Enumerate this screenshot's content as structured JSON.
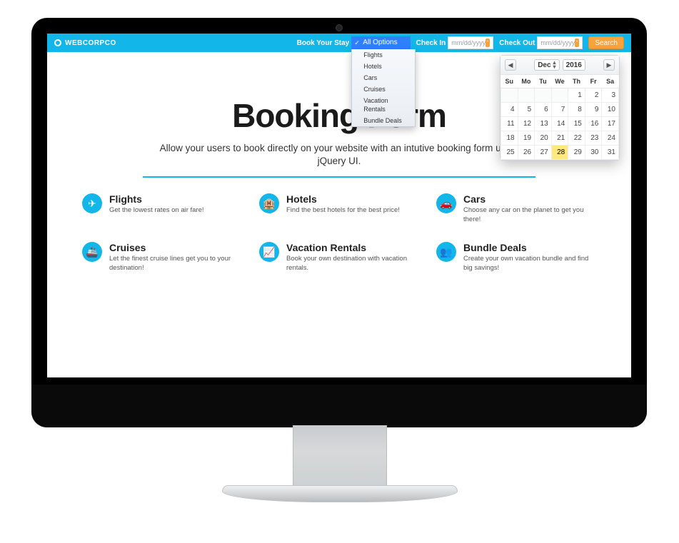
{
  "brand": {
    "name": "WEBCORPCO"
  },
  "topbar": {
    "book_label": "Book Your Stay",
    "checkin_label": "Check In",
    "checkout_label": "Check Out",
    "date_placeholder": "mm/dd/yyyy",
    "search_label": "Search",
    "select_selected": "All Options",
    "select_options": [
      "Flights",
      "Hotels",
      "Cars",
      "Cruises",
      "Vacation Rentals",
      "Bundle Deals"
    ]
  },
  "hero": {
    "title": "Booking Form",
    "subtitle": "Allow your users to book directly on your website with an intutive booking form using jQuery UI."
  },
  "features": [
    {
      "icon": "✈",
      "title": "Flights",
      "desc": "Get the lowest rates on air fare!"
    },
    {
      "icon": "🏨",
      "title": "Hotels",
      "desc": "Find the best hotels for the best price!"
    },
    {
      "icon": "🚗",
      "title": "Cars",
      "desc": "Choose any car on the planet to get you there!"
    },
    {
      "icon": "🚢",
      "title": "Cruises",
      "desc": "Let the finest cruise lines get you to your destination!"
    },
    {
      "icon": "📈",
      "title": "Vacation Rentals",
      "desc": "Book your own destination with vacation rentals."
    },
    {
      "icon": "👥",
      "title": "Bundle Deals",
      "desc": "Create your own vacation bundle and find big savings!"
    }
  ],
  "datepicker": {
    "month": "Dec",
    "year": "2016",
    "dow": [
      "Su",
      "Mo",
      "Tu",
      "We",
      "Th",
      "Fr",
      "Sa"
    ],
    "weeks": [
      [
        {
          "d": "",
          "o": true
        },
        {
          "d": "",
          "o": true
        },
        {
          "d": "",
          "o": true
        },
        {
          "d": "",
          "o": true
        },
        {
          "d": "1"
        },
        {
          "d": "2"
        },
        {
          "d": "3"
        }
      ],
      [
        {
          "d": "4"
        },
        {
          "d": "5"
        },
        {
          "d": "6"
        },
        {
          "d": "7"
        },
        {
          "d": "8"
        },
        {
          "d": "9"
        },
        {
          "d": "10"
        }
      ],
      [
        {
          "d": "11"
        },
        {
          "d": "12"
        },
        {
          "d": "13"
        },
        {
          "d": "14"
        },
        {
          "d": "15"
        },
        {
          "d": "16"
        },
        {
          "d": "17"
        }
      ],
      [
        {
          "d": "18"
        },
        {
          "d": "19"
        },
        {
          "d": "20"
        },
        {
          "d": "21"
        },
        {
          "d": "22"
        },
        {
          "d": "23"
        },
        {
          "d": "24"
        }
      ],
      [
        {
          "d": "25"
        },
        {
          "d": "26"
        },
        {
          "d": "27"
        },
        {
          "d": "28",
          "today": true
        },
        {
          "d": "29"
        },
        {
          "d": "30"
        },
        {
          "d": "31"
        }
      ]
    ]
  }
}
